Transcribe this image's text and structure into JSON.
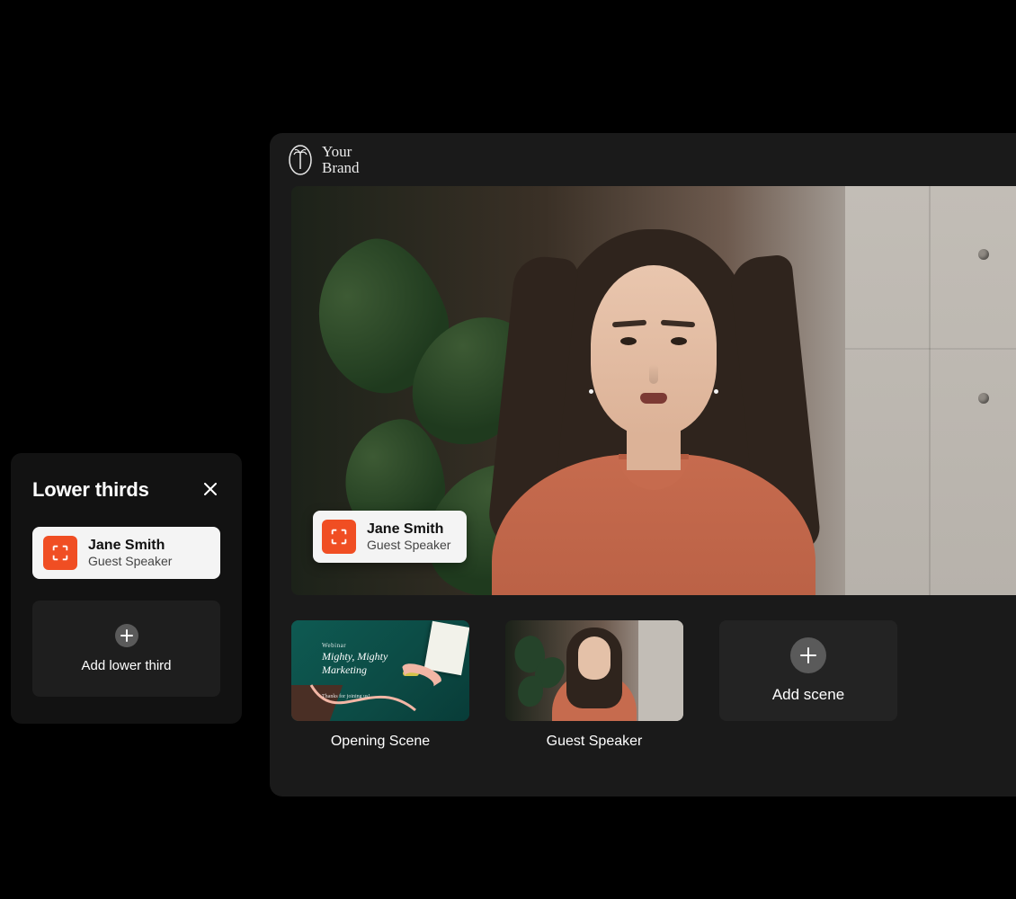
{
  "brand": {
    "line1": "Your",
    "line2": "Brand"
  },
  "lowerThirdsPanel": {
    "title": "Lower thirds",
    "item": {
      "name": "Jane Smith",
      "role": "Guest Speaker"
    },
    "addLabel": "Add lower third"
  },
  "overlay": {
    "name": "Jane Smith",
    "role": "Guest Speaker"
  },
  "scenes": [
    {
      "label": "Opening Scene",
      "kicker": "Webinar",
      "title1": "Mighty, Mighty",
      "title2": "Marketing",
      "sub": "Thanks for joining us!"
    },
    {
      "label": "Guest Speaker"
    }
  ],
  "addSceneLabel": "Add scene",
  "colors": {
    "accent": "#f04e23"
  }
}
